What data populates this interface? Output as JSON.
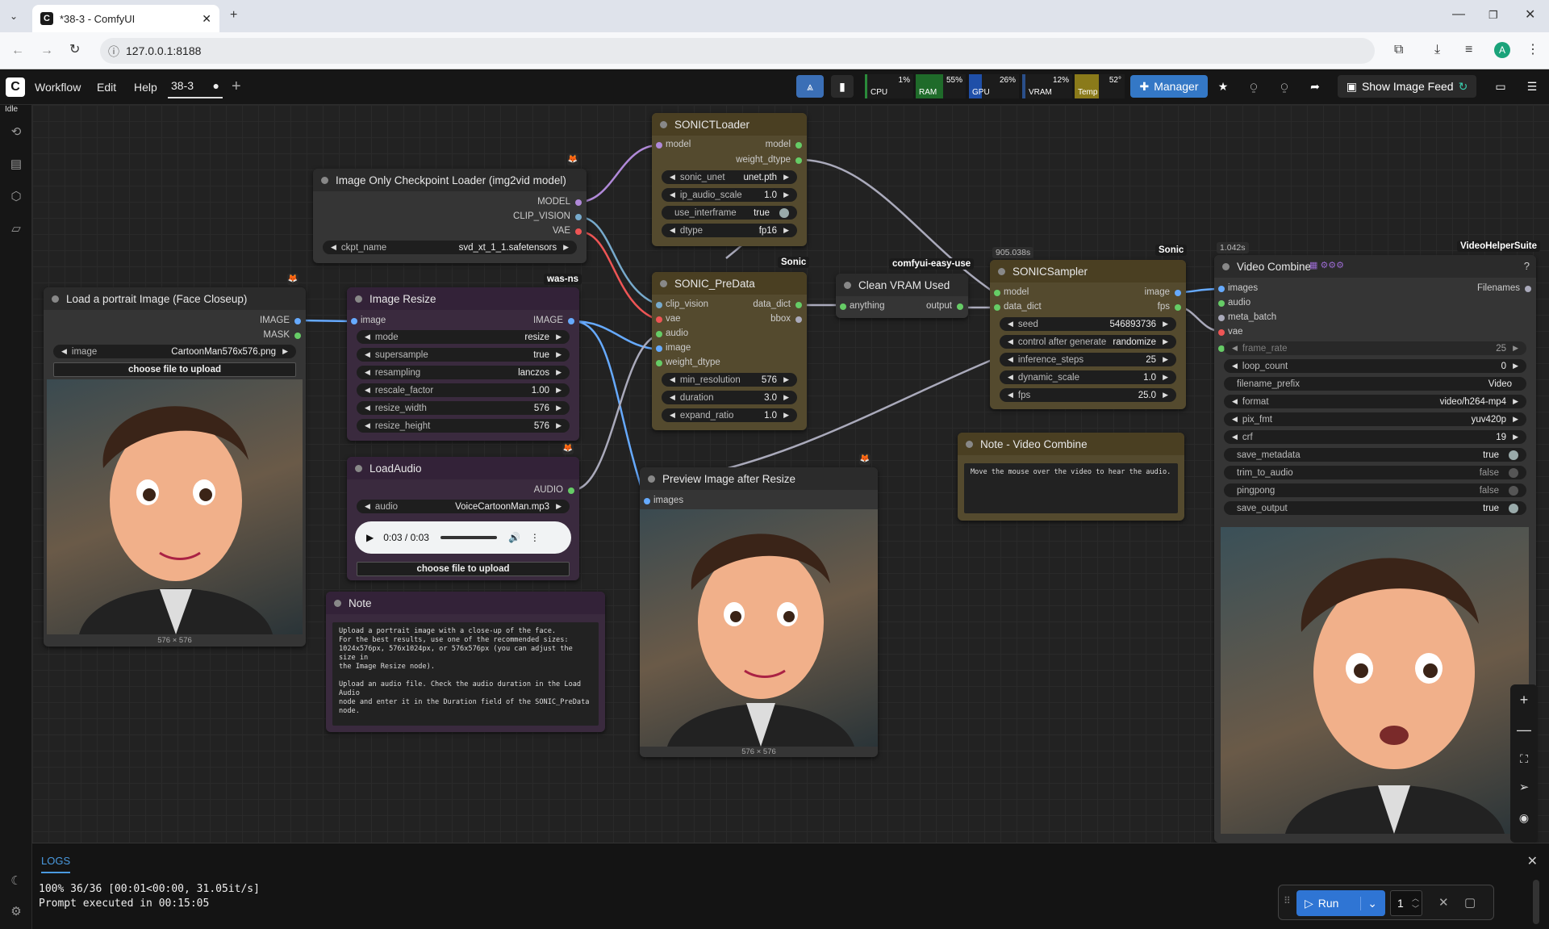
{
  "browser": {
    "tab_title": "*38-3 - ComfyUI",
    "url": "127.0.0.1:8188",
    "profile_initial": "A"
  },
  "comfy": {
    "menu": [
      "Workflow",
      "Edit",
      "Help"
    ],
    "workflow_tab": "38-3",
    "status": "Idle",
    "monitor": {
      "cpu_value": "1%",
      "cpu_label": "CPU",
      "ram_value": "55%",
      "ram_label": "RAM",
      "gpu_value": "26%",
      "gpu_label": "GPU",
      "vram_value": "12%",
      "vram_label": "VRAM",
      "temp_value": "52°",
      "temp_label": "Temp"
    },
    "manager_label": "Manager",
    "image_feed_label": "Show Image Feed"
  },
  "nodes": {
    "checkpoint": {
      "title": "Image Only Checkpoint Loader (img2vid model)",
      "outputs": [
        "MODEL",
        "CLIP_VISION",
        "VAE"
      ],
      "ckpt_label": "ckpt_name",
      "ckpt_value": "svd_xt_1_1.safetensors"
    },
    "sonic_loader": {
      "title": "SONICTLoader",
      "input": "model",
      "outputs": [
        "model",
        "weight_dtype"
      ],
      "widgets": [
        {
          "label": "sonic_unet",
          "value": "unet.pth"
        },
        {
          "label": "ip_audio_scale",
          "value": "1.0"
        },
        {
          "label": "use_interframe",
          "value": "true"
        },
        {
          "label": "dtype",
          "value": "fp16"
        }
      ]
    },
    "load_image": {
      "title": "Load a portrait Image (Face Closeup)",
      "outputs": [
        "IMAGE",
        "MASK"
      ],
      "image_label": "image",
      "image_value": "CartoonMan576x576.png",
      "upload": "choose file to upload",
      "size": "576 × 576"
    },
    "resize": {
      "title": "Image Resize",
      "badge": "was-ns",
      "input": "image",
      "output": "IMAGE",
      "widgets": [
        {
          "label": "mode",
          "value": "resize"
        },
        {
          "label": "supersample",
          "value": "true"
        },
        {
          "label": "resampling",
          "value": "lanczos"
        },
        {
          "label": "rescale_factor",
          "value": "1.00"
        },
        {
          "label": "resize_width",
          "value": "576"
        },
        {
          "label": "resize_height",
          "value": "576"
        }
      ]
    },
    "predata": {
      "title": "SONIC_PreData",
      "badge": "Sonic",
      "inputs": [
        "clip_vision",
        "vae",
        "audio",
        "image",
        "weight_dtype"
      ],
      "outputs": [
        "data_dict",
        "bbox"
      ],
      "widgets": [
        {
          "label": "min_resolution",
          "value": "576"
        },
        {
          "label": "duration",
          "value": "3.0"
        },
        {
          "label": "expand_ratio",
          "value": "1.0"
        }
      ]
    },
    "clean_vram": {
      "title": "Clean VRAM Used",
      "badge": "comfyui-easy-use",
      "input": "anything",
      "output": "output"
    },
    "sampler": {
      "title": "SONICSampler",
      "badge": "Sonic",
      "timing": "905.038s",
      "inputs": [
        "model",
        "data_dict"
      ],
      "outputs": [
        "image",
        "fps"
      ],
      "widgets": [
        {
          "label": "seed",
          "value": "546893736"
        },
        {
          "label": "control after generate",
          "value": "randomize"
        },
        {
          "label": "inference_steps",
          "value": "25"
        },
        {
          "label": "dynamic_scale",
          "value": "1.0"
        },
        {
          "label": "fps",
          "value": "25.0"
        }
      ]
    },
    "load_audio": {
      "title": "LoadAudio",
      "output": "AUDIO",
      "audio_label": "audio",
      "audio_value": "VoiceCartoonMan.mp3",
      "time": "0:03 / 0:03",
      "upload": "choose file to upload"
    },
    "preview": {
      "title": "Preview Image after Resize",
      "input": "images",
      "size": "576 × 576"
    },
    "note": {
      "title": "Note",
      "text": "Upload a portrait image with a close-up of the face.\nFor the best results, use one of the recommended sizes:\n1024x576px, 576x1024px, or 576x576px (you can adjust the size in\nthe Image Resize node).\n\nUpload an audio file. Check the audio duration in the Load Audio\nnode and enter it in the Duration field of the SONIC_PreData\nnode."
    },
    "note_video": {
      "title": "Note - Video Combine",
      "text": "Move the mouse over the video to hear the audio."
    },
    "video_combine": {
      "title": "Video Combine",
      "badge": "VideoHelperSuite",
      "timing": "1.042s",
      "inputs": [
        "images",
        "audio",
        "meta_batch",
        "vae"
      ],
      "output": "Filenames",
      "widgets": [
        {
          "label": "frame_rate",
          "value": "25"
        },
        {
          "label": "loop_count",
          "value": "0"
        },
        {
          "label": "filename_prefix",
          "value": "Video"
        },
        {
          "label": "format",
          "value": "video/h264-mp4"
        },
        {
          "label": "pix_fmt",
          "value": "yuv420p"
        },
        {
          "label": "crf",
          "value": "19"
        },
        {
          "label": "save_metadata",
          "value": "true"
        },
        {
          "label": "trim_to_audio",
          "value": "false"
        },
        {
          "label": "pingpong",
          "value": "false"
        },
        {
          "label": "save_output",
          "value": "true"
        }
      ]
    }
  },
  "logs": {
    "tab": "LOGS",
    "line1": "100% 36/36 [00:01<00:00, 31.05it/s]",
    "line2": "Prompt executed in 00:15:05"
  },
  "run": {
    "label": "Run",
    "count": "1"
  }
}
